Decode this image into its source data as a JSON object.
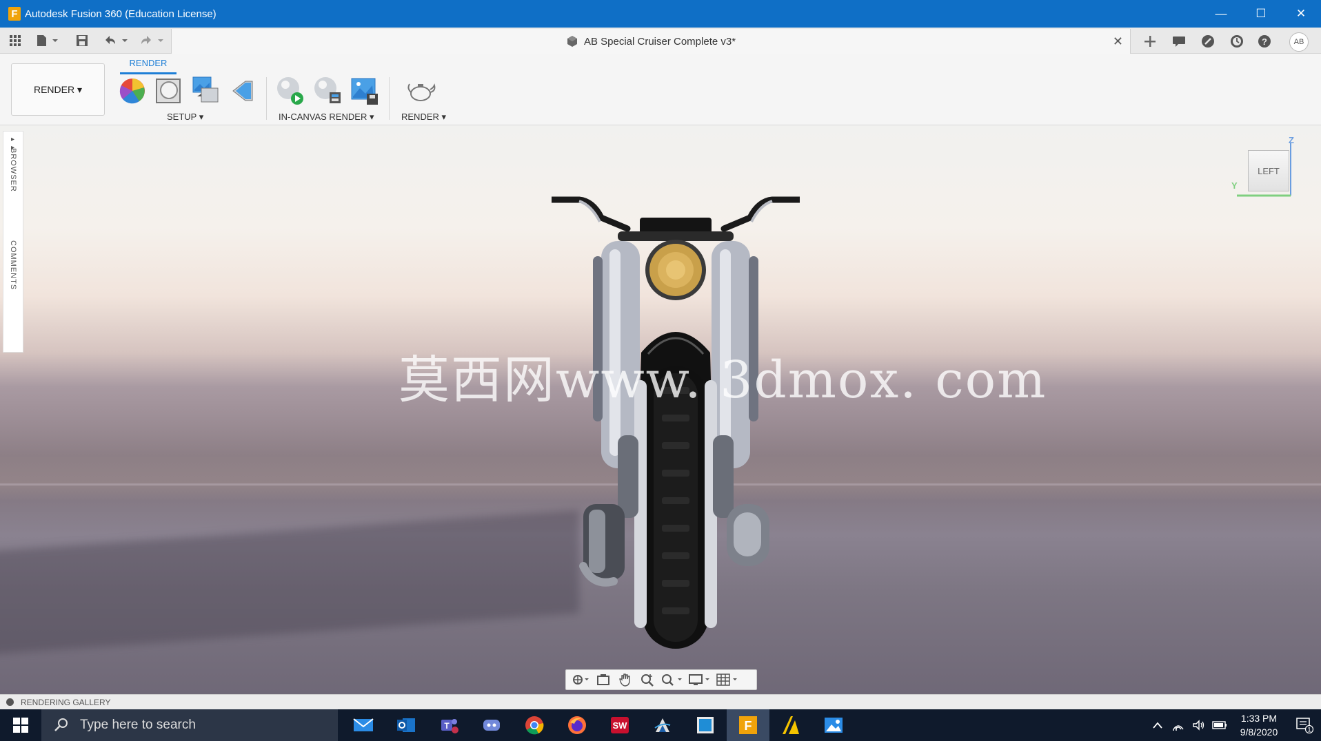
{
  "window": {
    "title": "Autodesk Fusion 360 (Education License)",
    "logo_letter": "F",
    "minimize": "—",
    "maximize": "☐",
    "close": "✕"
  },
  "document": {
    "title": "AB Special Cruiser Complete v3*",
    "close": "✕"
  },
  "user": {
    "initials": "AB"
  },
  "toolbar": {
    "workspace": "RENDER ▾",
    "active_tab": "RENDER",
    "groups": {
      "setup": "SETUP ▾",
      "in_canvas": "IN-CANVAS RENDER ▾",
      "render": "RENDER ▾"
    }
  },
  "side_panel": {
    "browser": "BROWSER",
    "comments": "COMMENTS",
    "expand": "▸▸"
  },
  "viewcube": {
    "face": "LEFT",
    "z_axis": "Z",
    "y_axis": "Y"
  },
  "watermark": "莫西网www. 3dmox. com",
  "gallery": {
    "label": "RENDERING GALLERY"
  },
  "taskbar": {
    "search_placeholder": "Type here to search",
    "time": "1:33 PM",
    "date": "9/8/2020",
    "apps": [
      "mail-app",
      "outlook-app",
      "teams-app",
      "discord-app",
      "chrome-app",
      "firefox-app",
      "solidworks-app",
      "ansys-app",
      "blue-app",
      "fusion-app",
      "autodesk-a-app",
      "photos-app"
    ],
    "notification_count": "1"
  },
  "colors": {
    "titlebar": "#0f6fc6",
    "accent": "#1e7fd6",
    "taskbar": "#0f1a2c"
  }
}
